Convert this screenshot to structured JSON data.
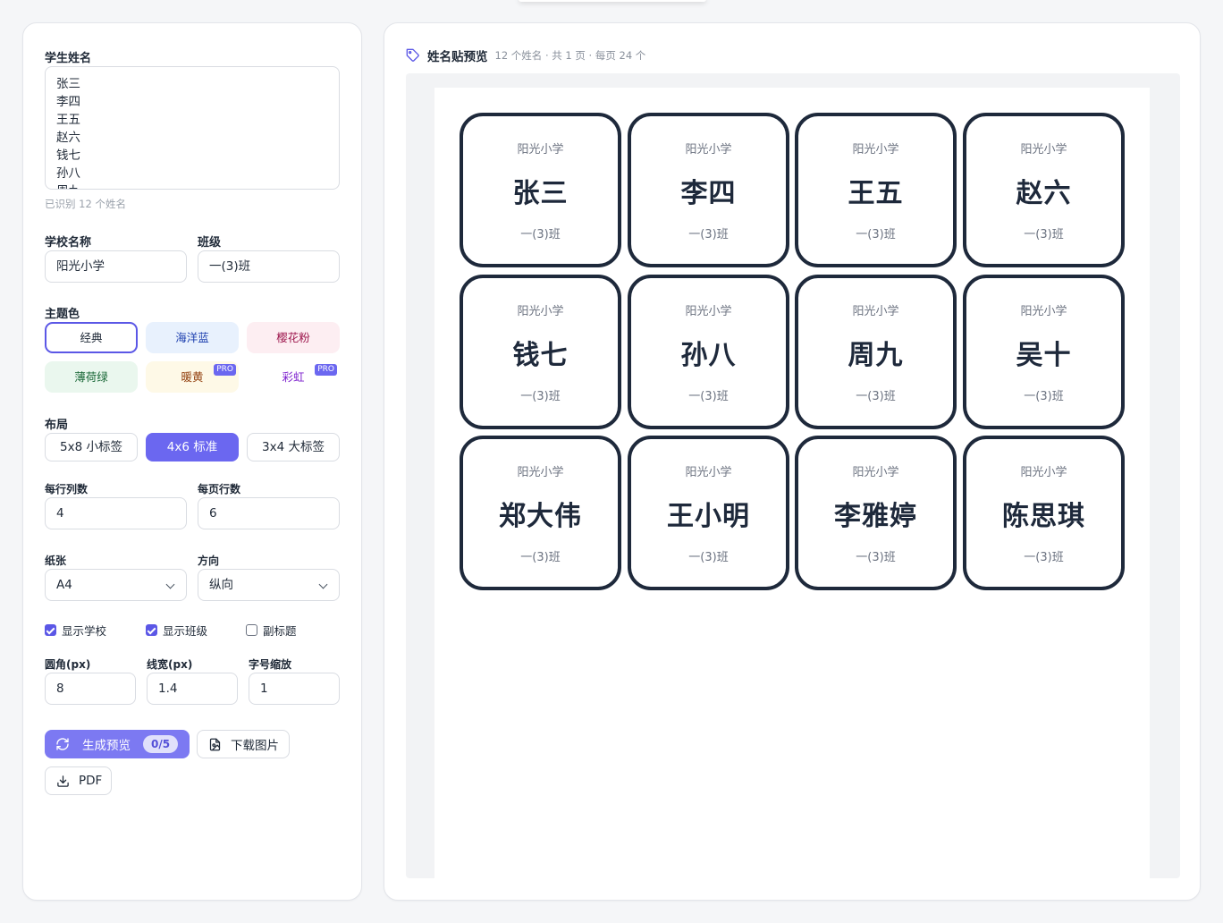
{
  "form": {
    "student_names_label": "学生姓名",
    "student_names": [
      "张三",
      "李四",
      "王五",
      "赵六",
      "钱七",
      "孙八",
      "周九"
    ],
    "recognized_hint": "已识别 12 个姓名",
    "school_label": "学校名称",
    "school_value": "阳光小学",
    "class_label": "班级",
    "class_value": "一(3)班",
    "theme_label": "主题色",
    "themes": [
      {
        "label": "经典",
        "pro": false,
        "selected": true
      },
      {
        "label": "海洋蓝",
        "pro": false,
        "selected": false
      },
      {
        "label": "樱花粉",
        "pro": false,
        "selected": false
      },
      {
        "label": "薄荷绿",
        "pro": false,
        "selected": false
      },
      {
        "label": "暖黄",
        "pro": true,
        "pro_label": "PRO",
        "selected": false
      },
      {
        "label": "彩虹",
        "pro": true,
        "pro_label": "PRO",
        "selected": false
      }
    ],
    "layout_label": "布局",
    "layouts": [
      {
        "label": "5x8 小标签",
        "active": false
      },
      {
        "label": "4x6 标准",
        "active": true
      },
      {
        "label": "3x4 大标签",
        "active": false
      }
    ],
    "cols_label": "每行列数",
    "cols_value": "4",
    "rows_label": "每页行数",
    "rows_value": "6",
    "paper_label": "纸张",
    "paper_value": "A4",
    "orientation_label": "方向",
    "orientation_value": "纵向",
    "show_school_label": "显示学校",
    "show_school": true,
    "show_class_label": "显示班级",
    "show_class": true,
    "subtitle_label": "副标题",
    "subtitle": false,
    "radius_label": "圆角(px)",
    "radius_value": "8",
    "stroke_label": "线宽(px)",
    "stroke_value": "1.4",
    "fontscale_label": "字号缩放",
    "fontscale_value": "1",
    "generate_label": "生成预览",
    "generate_count": "0/5",
    "download_image_label": "下载图片",
    "pdf_label": "PDF"
  },
  "preview": {
    "title": "姓名贴预览",
    "info": "12 个姓名 · 共 1 页 · 每页 24 个",
    "tags": [
      {
        "school": "阳光小学",
        "name": "张三",
        "class": "一(3)班"
      },
      {
        "school": "阳光小学",
        "name": "李四",
        "class": "一(3)班"
      },
      {
        "school": "阳光小学",
        "name": "王五",
        "class": "一(3)班"
      },
      {
        "school": "阳光小学",
        "name": "赵六",
        "class": "一(3)班"
      },
      {
        "school": "阳光小学",
        "name": "钱七",
        "class": "一(3)班"
      },
      {
        "school": "阳光小学",
        "name": "孙八",
        "class": "一(3)班"
      },
      {
        "school": "阳光小学",
        "name": "周九",
        "class": "一(3)班"
      },
      {
        "school": "阳光小学",
        "name": "吴十",
        "class": "一(3)班"
      },
      {
        "school": "阳光小学",
        "name": "郑大伟",
        "class": "一(3)班"
      },
      {
        "school": "阳光小学",
        "name": "王小明",
        "class": "一(3)班"
      },
      {
        "school": "阳光小学",
        "name": "李雅婷",
        "class": "一(3)班"
      },
      {
        "school": "阳光小学",
        "name": "陈思琪",
        "class": "一(3)班"
      }
    ]
  },
  "colors": {
    "accent": "#6b67f0",
    "tag_border": "#1e293b",
    "theme_ocean_bg": "#e8f1fd",
    "theme_sakura_bg": "#fdeef2",
    "theme_mint_bg": "#eaf7ee",
    "theme_warm_bg": "#fef9e7"
  },
  "icons": {
    "preview_title": "tag-icon",
    "generate": "refresh-icon",
    "download_image": "file-image-icon",
    "pdf": "download-icon"
  }
}
